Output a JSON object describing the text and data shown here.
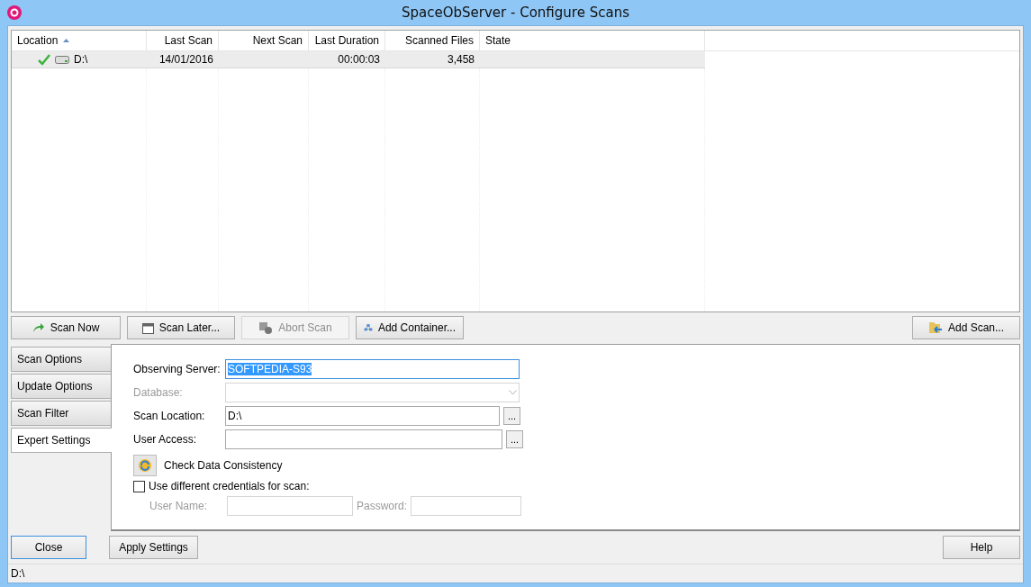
{
  "window": {
    "title": "SpaceObServer - Configure Scans"
  },
  "table": {
    "columns": [
      {
        "label": "Location",
        "sorted": true
      },
      {
        "label": "Last Scan",
        "sorted": false
      },
      {
        "label": "Next Scan",
        "sorted": false
      },
      {
        "label": "Last Duration",
        "sorted": false
      },
      {
        "label": "Scanned Files",
        "sorted": false
      },
      {
        "label": "State",
        "sorted": false
      }
    ],
    "rows": [
      {
        "selected": true,
        "scanned_ok": true,
        "cells": [
          "D:\\",
          "14/01/2016",
          "",
          "00:00:03",
          "3,458",
          ""
        ]
      }
    ]
  },
  "toolbar": [
    {
      "label": "Scan Now",
      "disabled": false
    },
    {
      "label": "Scan Later...",
      "disabled": false
    },
    {
      "label": "Abort Scan",
      "disabled": true
    },
    {
      "label": "Add Container...",
      "disabled": false
    }
  ],
  "add_scan": {
    "label": "Add Scan...",
    "disabled": false
  },
  "tabs": [
    {
      "label": "Scan Options",
      "selected": false
    },
    {
      "label": "Update Options",
      "selected": false
    },
    {
      "label": "Scan Filter",
      "selected": false
    },
    {
      "label": "Expert Settings",
      "selected": true
    }
  ],
  "form": {
    "fields": [
      {
        "kind": "text",
        "label": "Observing Server:",
        "value": "SOFTPEDIA-S93",
        "highlighted": true,
        "disabled": false,
        "browse": false
      },
      {
        "kind": "dropdown",
        "label": "Database:",
        "disabled": true,
        "browse": false
      },
      {
        "kind": "text",
        "label": "Scan Location:",
        "value": "D:\\",
        "disabled": false,
        "browse": true,
        "browse_label": "..."
      },
      {
        "kind": "text",
        "label": "User Access:",
        "disabled": false,
        "browse": true,
        "browse_label": "..."
      }
    ],
    "check_button": {
      "label": "Check Data Consistency"
    },
    "credentials": {
      "label": "Use different credentials for scan:",
      "checked": false
    },
    "user_name": {
      "label": "User Name:",
      "disabled": true
    },
    "password": {
      "label": "Password:",
      "disabled": true
    }
  },
  "bottom": {
    "close": {
      "label": "Close",
      "focused": true
    },
    "apply": {
      "label": "Apply Settings"
    },
    "help": {
      "label": "Help"
    }
  },
  "status_bar": {
    "text": "D:\\"
  }
}
